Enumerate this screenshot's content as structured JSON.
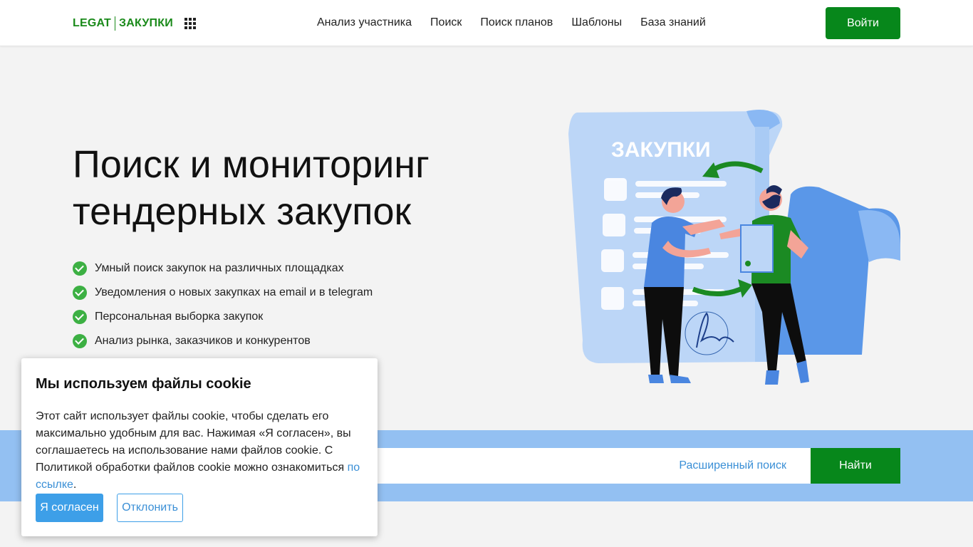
{
  "header": {
    "logo_left": "LEGAT",
    "logo_right": "ЗАКУПКИ",
    "apps_icon": "grid-icon",
    "nav": [
      {
        "label": "Анализ участника"
      },
      {
        "label": "Поиск"
      },
      {
        "label": "Поиск планов"
      },
      {
        "label": "Шаблоны"
      },
      {
        "label": "База знаний"
      }
    ],
    "login_label": "Войти"
  },
  "hero": {
    "title_line1": "Поиск и мониторинг",
    "title_line2": "тендерных закупок",
    "features": [
      {
        "text": "Умный поиск закупок на различных площадках"
      },
      {
        "text": "Уведомления о новых закупках на email и в telegram"
      },
      {
        "text": "Персональная выборка закупок"
      },
      {
        "text": "Анализ рынка, заказчиков и конкурентов"
      }
    ],
    "illustration_label": "ЗАКУПКИ"
  },
  "search": {
    "input_value": "",
    "input_placeholder": "",
    "advanced_label": "Расширенный поиск",
    "find_label": "Найти"
  },
  "cookie": {
    "title": "Мы используем файлы cookie",
    "text": "Этот сайт использует файлы cookie, чтобы сделать его максимально удобным для вас. Нажимая «Я согласен», вы соглашаетесь на использование нами файлов cookie. С Политикой обработки файлов cookie можно ознакомиться ",
    "link_label": "по ссылке",
    "text_end": ".",
    "accept_label": "Я согласен",
    "decline_label": "Отклонить"
  },
  "colors": {
    "brand_green": "#07871b",
    "accent_blue": "#3d9fe8",
    "band_blue": "#93c0f2"
  }
}
